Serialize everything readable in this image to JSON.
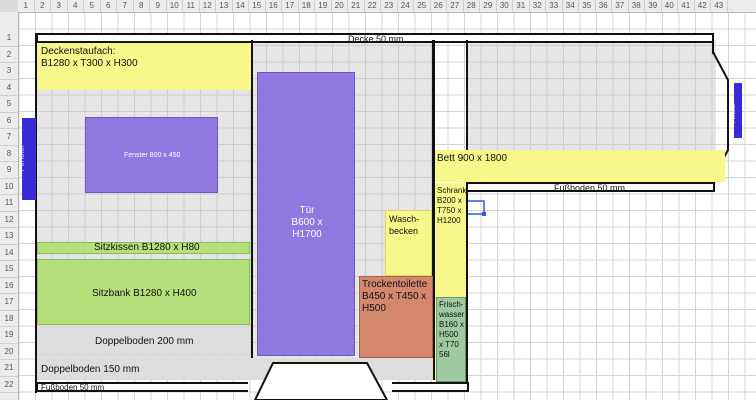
{
  "columns": [
    "1",
    "2",
    "3",
    "4",
    "5",
    "6",
    "7",
    "8",
    "9",
    "10",
    "11",
    "12",
    "13",
    "14",
    "15",
    "16",
    "17",
    "18",
    "19",
    "20",
    "21",
    "22",
    "23",
    "24",
    "25",
    "26",
    "27",
    "28",
    "29",
    "30",
    "31",
    "32",
    "33",
    "34",
    "35",
    "36",
    "37",
    "38",
    "39",
    "40",
    "41",
    "42",
    "43"
  ],
  "rows": [
    "1",
    "2",
    "3",
    "4",
    "5",
    "6",
    "7",
    "8",
    "9",
    "10",
    "11",
    "12",
    "13",
    "14",
    "15",
    "16",
    "17",
    "18",
    "19",
    "20",
    "21",
    "22"
  ],
  "labels": {
    "decke": "Decke 50 mm",
    "deckenstaufach": "Deckenstaufach:\nB1280 x T300 x H300",
    "fenster_left": "Fenster",
    "fenster_inner": "Fenster 800 x 450",
    "fenster_right": "Fenster",
    "tuer": "Tür\nB600 x H1700",
    "sitzkissen": "Sitzkissen B1280 x H80",
    "sitzbank": "Sitzbank B1280 x H400",
    "doppelboden_200": "Doppelboden 200 mm",
    "doppelboden_150": "Doppelboden 150 mm",
    "fussboden_left": "Fußboden 50 mm",
    "fussboden_right": "Fußboden 50 mm",
    "bett": "Bett 900 x 1800",
    "schrank": "Schrank\nB200 x\nT750 x\nH1200",
    "waschbecken": "Wasch-\nbecken",
    "trockentoilette": "Trockentoilette\nB450 x T450 x\nH500",
    "frischwasser": "Frisch-\nwasser\nB160 x\nH500\nx T70\n56l"
  },
  "colors": {
    "yellow": "#f7f78a",
    "green": "#b5e17c",
    "purple": "#8f78e0",
    "brown": "#d3886c",
    "sage": "#9fc99f",
    "window_blue": "#3b2bd6"
  }
}
